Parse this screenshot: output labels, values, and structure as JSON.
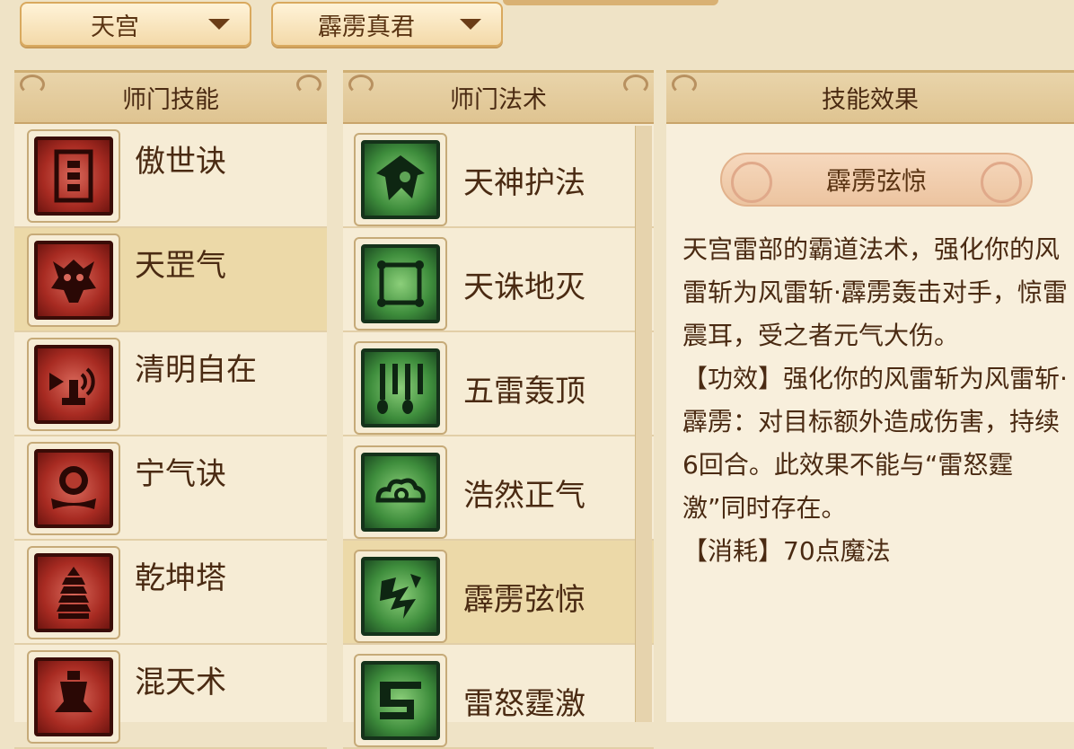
{
  "dropdowns": {
    "sect": "天宫",
    "master": "霹雳真君"
  },
  "skills_panel": {
    "title": "师门技能",
    "items": [
      {
        "label": "傲世诀",
        "icon": "scroll-icon"
      },
      {
        "label": "天罡气",
        "icon": "demon-icon",
        "selected": true
      },
      {
        "label": "清明自在",
        "icon": "broadcast-icon"
      },
      {
        "label": "宁气诀",
        "icon": "orb-icon"
      },
      {
        "label": "乾坤塔",
        "icon": "pagoda-icon"
      },
      {
        "label": "混天术",
        "icon": "figure-icon"
      }
    ]
  },
  "spells_panel": {
    "title": "师门法术",
    "items": [
      {
        "label": "天神护法",
        "icon": "guardian-icon"
      },
      {
        "label": "天诛地灭",
        "icon": "frame-icon"
      },
      {
        "label": "五雷轰顶",
        "icon": "thunder-icon"
      },
      {
        "label": "浩然正气",
        "icon": "cloud-icon"
      },
      {
        "label": "霹雳弦惊",
        "icon": "lightning-icon",
        "selected": true
      },
      {
        "label": "雷怒霆激",
        "icon": "rune-icon"
      }
    ]
  },
  "effect_panel": {
    "title": "技能效果",
    "skill_name": "霹雳弦惊",
    "description": "天宫雷部的霸道法术，强化你的风雷斩为风雷斩·霹雳轰击对手，惊雷震耳，受之者元气大伤。",
    "effect": "【功效】强化你的风雷斩为风雷斩·霹雳：对目标额外造成伤害，持续6回合。此效果不能与“雷怒霆激”同时存在。",
    "cost": "【消耗】70点魔法"
  },
  "colors": {
    "skill_icon_bg": "#a82b22",
    "spell_icon_bg": "#3e8d3c",
    "selected_row": "#ecd9a8",
    "panel_bg": "#f6ecd5"
  }
}
